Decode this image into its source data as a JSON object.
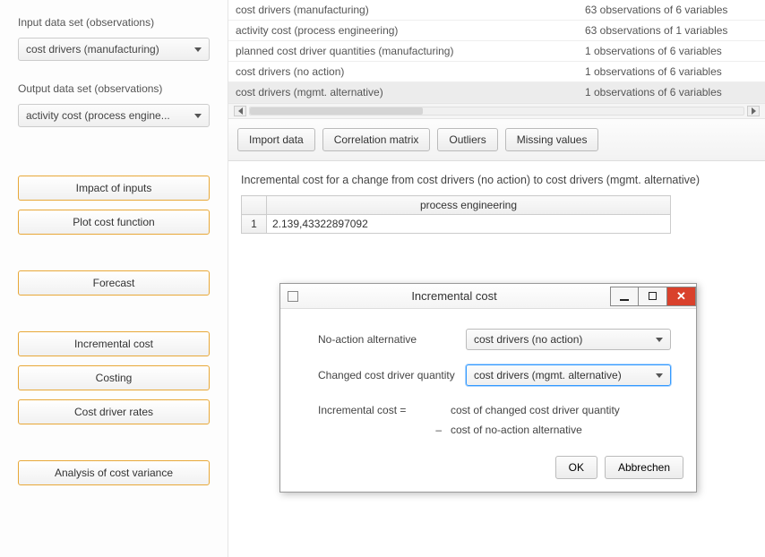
{
  "sidebar": {
    "input_label": "Input data set (observations)",
    "input_selected": "cost drivers (manufacturing)",
    "output_label": "Output data set (observations)",
    "output_selected": "activity cost (process engine...",
    "buttons": {
      "impact": "Impact of inputs",
      "plot": "Plot cost function",
      "forecast": "Forecast",
      "incremental": "Incremental cost",
      "costing": "Costing",
      "rates": "Cost driver rates",
      "variance": "Analysis of cost variance"
    }
  },
  "datasets": [
    {
      "name": "cost drivers (manufacturing)",
      "meta": "63 observations of 6 variables"
    },
    {
      "name": "activity cost (process engineering)",
      "meta": "63 observations of 1 variables"
    },
    {
      "name": "planned cost driver quantities (manufacturing)",
      "meta": "1 observations of 6 variables"
    },
    {
      "name": "cost drivers (no action)",
      "meta": "1 observations of 6 variables"
    },
    {
      "name": "cost drivers (mgmt. alternative)",
      "meta": "1 observations of 6 variables"
    }
  ],
  "toolbar": {
    "import": "Import data",
    "corr": "Correlation matrix",
    "outliers": "Outliers",
    "missing": "Missing values"
  },
  "heading": "Incremental cost for a change from cost drivers (no action) to cost drivers (mgmt. alternative)",
  "result": {
    "col": "process engineering",
    "row": "1",
    "value": "2.139,43322897092"
  },
  "dialog": {
    "title": "Incremental cost",
    "noaction_label": "No-action alternative",
    "noaction_value": "cost drivers (no action)",
    "changed_label": "Changed cost driver quantity",
    "changed_value": "cost drivers (mgmt. alternative)",
    "formula_lhs": "Incremental cost   =",
    "formula_r1": "cost of changed cost driver quantity",
    "formula_minus": "–",
    "formula_r2": "cost of no-action alternative",
    "ok": "OK",
    "cancel": "Abbrechen"
  }
}
